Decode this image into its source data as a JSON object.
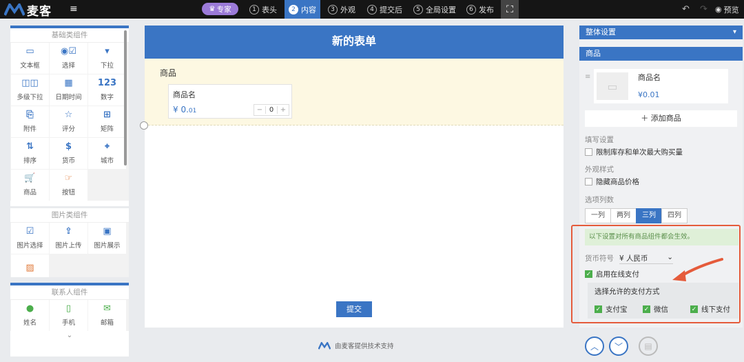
{
  "app": {
    "brand": "麦客",
    "expert_badge": "专家",
    "menu_icon": "hamburger-icon"
  },
  "steps": [
    {
      "num": "1",
      "label": "表头"
    },
    {
      "num": "2",
      "label": "内容"
    },
    {
      "num": "3",
      "label": "外观"
    },
    {
      "num": "4",
      "label": "提交后"
    },
    {
      "num": "5",
      "label": "全局设置"
    },
    {
      "num": "6",
      "label": "发布"
    }
  ],
  "active_step": "内容",
  "topbar": {
    "preview_label": "预览"
  },
  "left": {
    "basic_title": "基础类组件",
    "basic": [
      {
        "icon": "▭",
        "label": "文本框"
      },
      {
        "icon": "◉☑",
        "label": "选择"
      },
      {
        "icon": "▾",
        "label": "下拉"
      },
      {
        "icon": "◫◫",
        "label": "多级下拉"
      },
      {
        "icon": "▦",
        "label": "日期时间"
      },
      {
        "icon": "123",
        "label": "数字"
      },
      {
        "icon": "⎘",
        "label": "附件"
      },
      {
        "icon": "☆",
        "label": "评分"
      },
      {
        "icon": "⊞",
        "label": "矩阵"
      },
      {
        "icon": "⇅",
        "label": "排序"
      },
      {
        "icon": "$",
        "label": "货币"
      },
      {
        "icon": "⌖",
        "label": "城市"
      },
      {
        "icon": "🛒",
        "label": "商品"
      },
      {
        "icon": "☞",
        "label": "按钮"
      }
    ],
    "image_title": "图片类组件",
    "image": [
      {
        "icon": "☑",
        "label": "图片选择"
      },
      {
        "icon": "⇪",
        "label": "图片上传"
      },
      {
        "icon": "▣",
        "label": "图片展示"
      },
      {
        "icon": "▨",
        "label": ""
      }
    ],
    "contact_title": "联系人组件",
    "contact": [
      {
        "icon": "●",
        "label": "姓名"
      },
      {
        "icon": "▯",
        "label": "手机"
      },
      {
        "icon": "✉",
        "label": "邮箱"
      }
    ],
    "more_icon": "chevron-down-icon"
  },
  "form": {
    "title": "新的表单",
    "section_title": "商品",
    "product_name": "商品名",
    "price_symbol": "¥",
    "price_int": "0.",
    "price_dec": "01",
    "minus": "−",
    "qty": "0",
    "plus": "+",
    "submit_label": "提交"
  },
  "footer_note": "由麦客提供技术支持",
  "right": {
    "overall_title": "整体设置",
    "product_title": "商品",
    "product_name": "商品名",
    "product_price": "¥0.01",
    "add_product": "＋ 添加商品",
    "fill_label": "填写设置",
    "limit_label": "限制库存和单次最大购买量",
    "appearance_label": "外观样式",
    "hide_price_label": "隐藏商品价格",
    "columns_label": "选项列数",
    "columns": [
      "一列",
      "两列",
      "三列",
      "四列"
    ],
    "selected_column": "三列",
    "notice": "以下设置对所有商品组件都会生效。",
    "currency_label": "货币符号",
    "currency_value": "¥ 人民币",
    "online_pay_label": "启用在线支付",
    "online_pay_checked": true,
    "pay_methods_title": "选择允许的支付方式",
    "pay_methods": [
      "支付宝",
      "微信",
      "线下支付"
    ]
  },
  "colors": {
    "accent": "#3a75c4",
    "highlight_border": "#e55b3b",
    "check_green": "#4cae4c",
    "section_bg": "#fdf8e2"
  }
}
